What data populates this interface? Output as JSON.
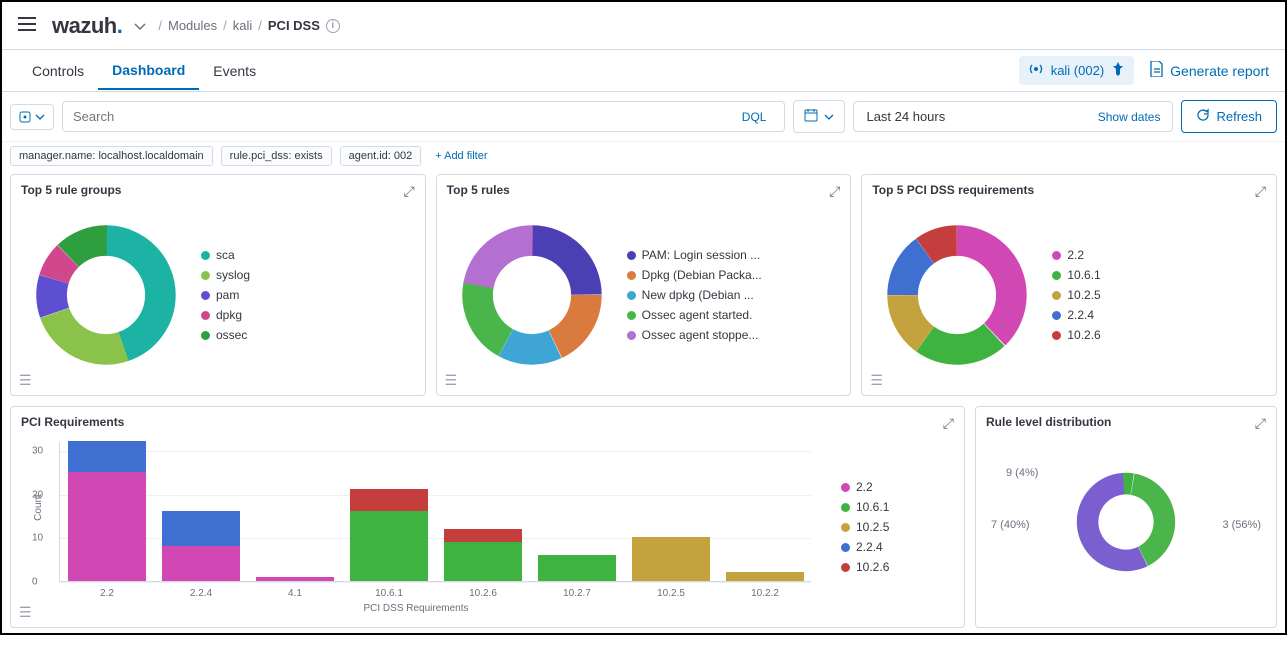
{
  "header": {
    "logo": "wazuh",
    "breadcrumb": {
      "modules": "Modules",
      "agent": "kali",
      "current": "PCI DSS"
    }
  },
  "tabs": {
    "controls": "Controls",
    "dashboard": "Dashboard",
    "events": "Events"
  },
  "agent_badge": "kali (002)",
  "generate_report": "Generate report",
  "search": {
    "placeholder": "Search",
    "dql": "DQL"
  },
  "time": {
    "range": "Last 24 hours",
    "show_dates": "Show dates",
    "refresh": "Refresh"
  },
  "filters": {
    "chips": [
      "manager.name: localhost.localdomain",
      "rule.pci_dss: exists",
      "agent.id: 002"
    ],
    "add": "+ Add filter"
  },
  "panels": {
    "rule_groups": {
      "title": "Top 5 rule groups",
      "legend": [
        {
          "label": "sca",
          "color": "#1cb3a5"
        },
        {
          "label": "syslog",
          "color": "#8bc34a"
        },
        {
          "label": "pam",
          "color": "#5e4fd1"
        },
        {
          "label": "dpkg",
          "color": "#d1478c"
        },
        {
          "label": "ossec",
          "color": "#2e9e3f"
        }
      ]
    },
    "rules": {
      "title": "Top 5 rules",
      "legend": [
        {
          "label": "PAM: Login session ...",
          "color": "#4b3fb3"
        },
        {
          "label": "Dpkg (Debian Packa...",
          "color": "#d97b3e"
        },
        {
          "label": "New dpkg (Debian ...",
          "color": "#3ea5d4"
        },
        {
          "label": "Ossec agent started.",
          "color": "#4ab54a"
        },
        {
          "label": "Ossec agent stoppe...",
          "color": "#b46fd1"
        }
      ]
    },
    "pci_req_top5": {
      "title": "Top 5 PCI DSS requirements",
      "legend": [
        {
          "label": "2.2",
          "color": "#d147b3"
        },
        {
          "label": "10.6.1",
          "color": "#3fb33f"
        },
        {
          "label": "10.2.5",
          "color": "#c4a23e"
        },
        {
          "label": "2.2.4",
          "color": "#3e6fd1"
        },
        {
          "label": "10.2.6",
          "color": "#c43e3e"
        }
      ]
    },
    "pci_requirements": {
      "title": "PCI Requirements",
      "ylabel": "Count",
      "xlabel": "PCI DSS Requirements",
      "legend": [
        {
          "label": "2.2",
          "color": "#d147b3"
        },
        {
          "label": "10.6.1",
          "color": "#3fb33f"
        },
        {
          "label": "10.2.5",
          "color": "#c4a23e"
        },
        {
          "label": "2.2.4",
          "color": "#3e6fd1"
        },
        {
          "label": "10.2.6",
          "color": "#c43e3e"
        }
      ]
    },
    "rule_level": {
      "title": "Rule level distribution",
      "labels": {
        "a": "9 (4%)",
        "b": "7 (40%)",
        "c": "3 (56%)"
      }
    }
  },
  "chart_data": [
    {
      "id": "rule_groups",
      "type": "pie",
      "series": [
        {
          "name": "sca",
          "value": 45
        },
        {
          "name": "syslog",
          "value": 25
        },
        {
          "name": "pam",
          "value": 10
        },
        {
          "name": "dpkg",
          "value": 8
        },
        {
          "name": "ossec",
          "value": 12
        }
      ]
    },
    {
      "id": "rules",
      "type": "pie",
      "series": [
        {
          "name": "PAM: Login session ...",
          "value": 25
        },
        {
          "name": "Dpkg (Debian Packa...",
          "value": 18
        },
        {
          "name": "New dpkg (Debian ...",
          "value": 15
        },
        {
          "name": "Ossec agent started.",
          "value": 20
        },
        {
          "name": "Ossec agent stoppe...",
          "value": 22
        }
      ]
    },
    {
      "id": "pci_req_top5",
      "type": "pie",
      "series": [
        {
          "name": "2.2",
          "value": 38
        },
        {
          "name": "10.6.1",
          "value": 22
        },
        {
          "name": "10.2.5",
          "value": 15
        },
        {
          "name": "2.2.4",
          "value": 15
        },
        {
          "name": "10.2.6",
          "value": 10
        }
      ]
    },
    {
      "id": "pci_requirements",
      "type": "bar",
      "ylabel": "Count",
      "xlabel": "PCI DSS Requirements",
      "ylim": [
        0,
        32
      ],
      "yticks": [
        0,
        10,
        20,
        30
      ],
      "categories": [
        "2.2",
        "2.2.4",
        "4.1",
        "10.6.1",
        "10.2.6",
        "10.2.7",
        "10.2.5",
        "10.2.2"
      ],
      "series": [
        {
          "name": "2.2",
          "color": "#d147b3",
          "values": [
            25,
            8,
            1,
            0,
            0,
            0,
            0,
            0
          ]
        },
        {
          "name": "10.6.1",
          "color": "#3fb33f",
          "values": [
            0,
            0,
            0,
            16,
            9,
            6,
            0,
            0
          ]
        },
        {
          "name": "10.2.5",
          "color": "#c4a23e",
          "values": [
            0,
            0,
            0,
            0,
            0,
            0,
            10,
            2
          ]
        },
        {
          "name": "2.2.4",
          "color": "#3e6fd1",
          "values": [
            7,
            8,
            0,
            0,
            0,
            0,
            0,
            0
          ]
        },
        {
          "name": "10.2.6",
          "color": "#c43e3e",
          "values": [
            0,
            0,
            0,
            5,
            3,
            0,
            0,
            0
          ]
        }
      ]
    },
    {
      "id": "rule_level",
      "type": "pie",
      "series": [
        {
          "name": "9",
          "value": 4,
          "pct": "4%"
        },
        {
          "name": "7",
          "value": 40,
          "pct": "40%"
        },
        {
          "name": "3",
          "value": 56,
          "pct": "56%"
        }
      ]
    }
  ]
}
